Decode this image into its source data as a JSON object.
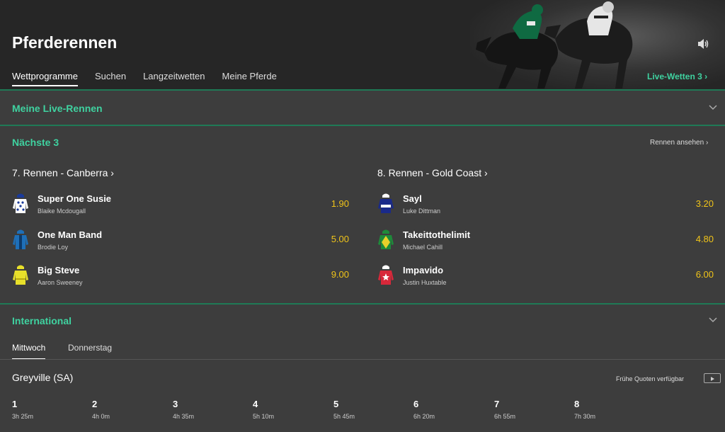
{
  "header": {
    "title": "Pferderennen",
    "nav": [
      "Wettprogramme",
      "Suchen",
      "Langzeitwetten",
      "Meine Pferde"
    ],
    "live_link": "Live-Wetten 3 ›"
  },
  "live_section": {
    "title": "Meine Live-Rennen"
  },
  "next": {
    "title": "Nächste 3",
    "watch_link": "Rennen ansehen ›",
    "races": [
      {
        "heading": "7. Rennen - Canberra ›",
        "runners": [
          {
            "name": "Super One Susie",
            "jockey": "Blaike Mcdougall",
            "odds": "1.90"
          },
          {
            "name": "One Man Band",
            "jockey": "Brodie Loy",
            "odds": "5.00"
          },
          {
            "name": "Big Steve",
            "jockey": "Aaron Sweeney",
            "odds": "9.00"
          }
        ]
      },
      {
        "heading": "8. Rennen - Gold Coast ›",
        "runners": [
          {
            "name": "Sayl",
            "jockey": "Luke Dittman",
            "odds": "3.20"
          },
          {
            "name": "Takeittothelimit",
            "jockey": "Michael Cahill",
            "odds": "4.80"
          },
          {
            "name": "Impavido",
            "jockey": "Justin Huxtable",
            "odds": "6.00"
          }
        ]
      }
    ]
  },
  "international": {
    "title": "International",
    "days": [
      "Mittwoch",
      "Donnerstag"
    ],
    "meeting": "Greyville (SA)",
    "early_odds": "Frühe Quoten verfügbar",
    "races": [
      {
        "num": "1",
        "time": "3h 25m"
      },
      {
        "num": "2",
        "time": "4h 0m"
      },
      {
        "num": "3",
        "time": "4h 35m"
      },
      {
        "num": "4",
        "time": "5h 10m"
      },
      {
        "num": "5",
        "time": "5h 45m"
      },
      {
        "num": "6",
        "time": "6h 20m"
      },
      {
        "num": "7",
        "time": "6h 55m"
      },
      {
        "num": "8",
        "time": "7h 30m"
      }
    ]
  },
  "colors": {
    "accent": "#3fd2a0",
    "odds": "#f0c419",
    "background": "#3d3d3d"
  },
  "icons": [
    "sound-icon",
    "chevron-right-icon",
    "chevron-down-icon",
    "jockey-silk-icon",
    "play-icon"
  ]
}
